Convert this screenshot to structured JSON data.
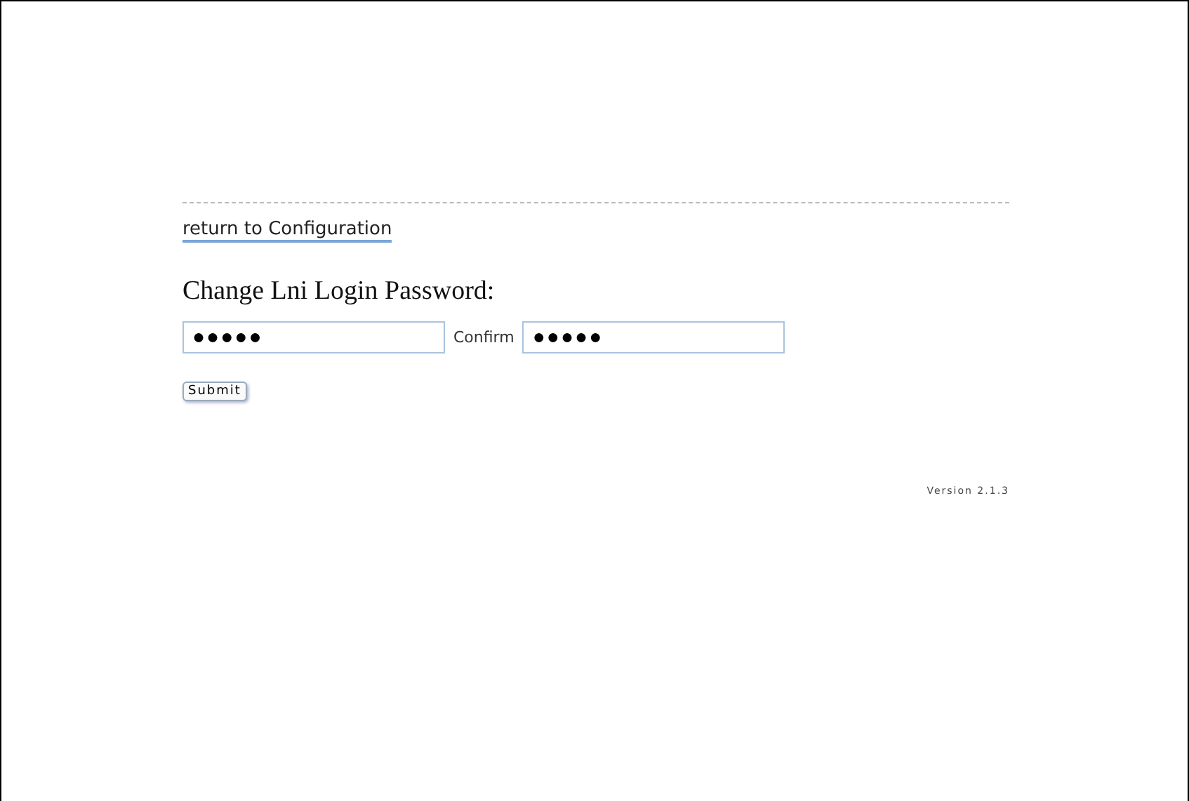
{
  "link": "return to Configuration",
  "heading": "Change Lni Login Password:",
  "password": {
    "value": "●●●●●"
  },
  "confirm": {
    "label": "Confirm",
    "value": "●●●●●"
  },
  "submit": "Submit",
  "version": "Version 2.1.3"
}
